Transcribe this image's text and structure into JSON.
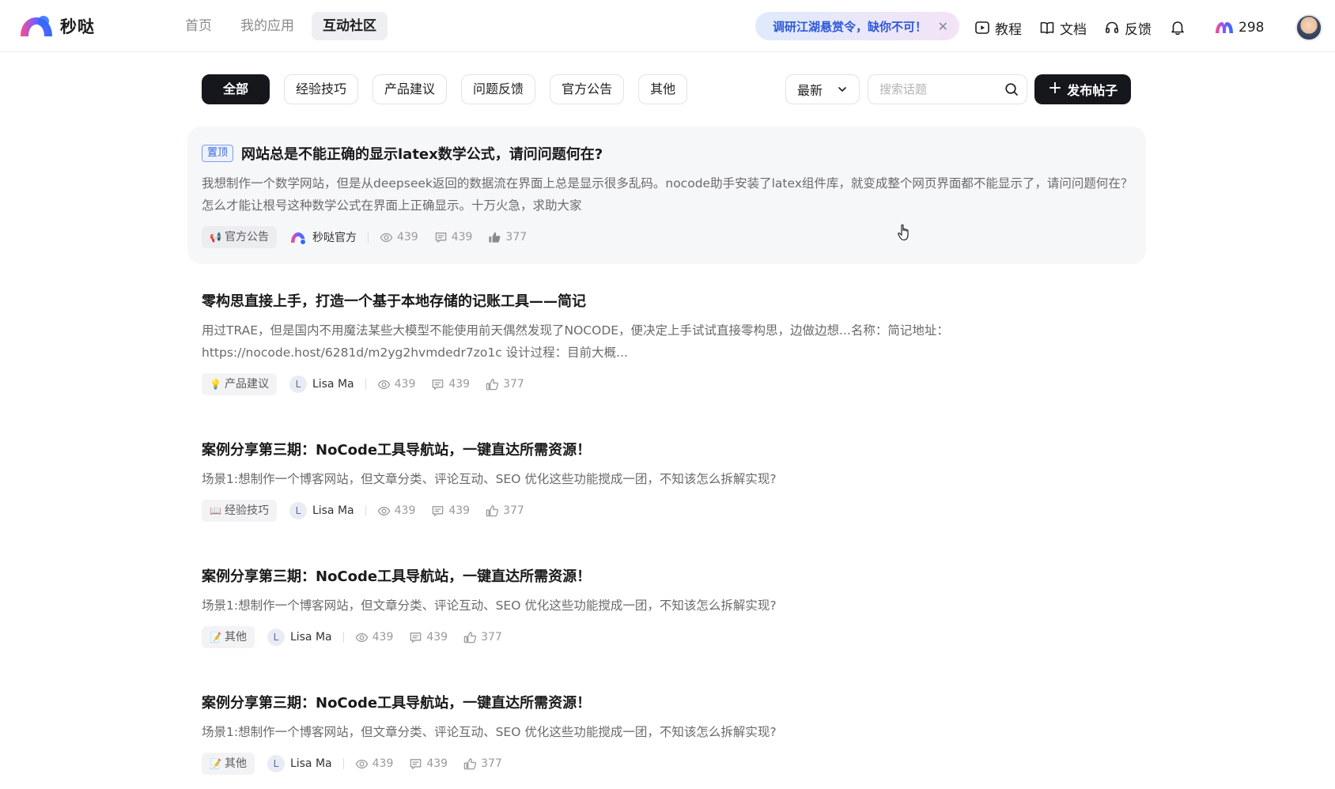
{
  "header": {
    "logo_text": "秒哒",
    "nav": [
      {
        "label": "首页",
        "active": false
      },
      {
        "label": "我的应用",
        "active": false
      },
      {
        "label": "互动社区",
        "active": true
      }
    ],
    "promo": {
      "text": "调研江湖悬赏令，缺你不可！"
    },
    "links": {
      "tutorial": "教程",
      "docs": "文档",
      "feedback": "反馈"
    },
    "credits": "298"
  },
  "filters": {
    "categories": [
      {
        "label": "全部",
        "active": true
      },
      {
        "label": "经验技巧",
        "active": false
      },
      {
        "label": "产品建议",
        "active": false
      },
      {
        "label": "问题反馈",
        "active": false
      },
      {
        "label": "官方公告",
        "active": false
      },
      {
        "label": "其他",
        "active": false
      }
    ],
    "sort": {
      "selected": "最新"
    },
    "search": {
      "placeholder": "搜索话题",
      "value": ""
    },
    "publish_label": "发布帖子"
  },
  "posts": [
    {
      "pinned": true,
      "pin_label": "置顶",
      "title": "网站总是不能正确的显示latex数学公式，请问问题何在?",
      "excerpt": "我想制作一个数学网站，但是从deepseek返回的数据流在界面上总是显示很多乱码。nocode助手安装了latex组件库，就变成整个网页界面都不能显示了，请问问题何在？怎么才能让根号这种数学公式在界面上正确显示。十万火急，求助大家",
      "category": "官方公告",
      "category_icon": "megaphone-icon",
      "author": "秒哒官方",
      "author_initial": "",
      "views": "439",
      "comments": "439",
      "likes": "377"
    },
    {
      "pinned": false,
      "title": "零构思直接上手，打造一个基于本地存储的记账工具——简记",
      "excerpt": "用过TRAE，但是国内不用魔法某些大模型不能使用前天偶然发现了NOCODE，便决定上手试试直接零构思，边做边想...名称：简记地址： https://nocode.host/6281d/m2yg2hvmdedr7zo1c 设计过程：目前大概...",
      "category": "产品建议",
      "category_icon": "lightbulb-icon",
      "author": "Lisa Ma",
      "author_initial": "L",
      "views": "439",
      "comments": "439",
      "likes": "377"
    },
    {
      "pinned": false,
      "title": "案例分享第三期：NoCode工具导航站，一键直达所需资源！",
      "excerpt": "场景1:想制作一个博客网站，但文章分类、评论互动、SEO 优化这些功能搅成一团，不知该怎么拆解实现?",
      "category": "经验技巧",
      "category_icon": "book-icon",
      "author": "Lisa Ma",
      "author_initial": "L",
      "views": "439",
      "comments": "439",
      "likes": "377"
    },
    {
      "pinned": false,
      "title": "案例分享第三期：NoCode工具导航站，一键直达所需资源！",
      "excerpt": "场景1:想制作一个博客网站，但文章分类、评论互动、SEO 优化这些功能搅成一团，不知该怎么拆解实现?",
      "category": "其他",
      "category_icon": "memo-icon",
      "author": "Lisa Ma",
      "author_initial": "L",
      "views": "439",
      "comments": "439",
      "likes": "377"
    },
    {
      "pinned": false,
      "title": "案例分享第三期：NoCode工具导航站，一键直达所需资源！",
      "excerpt": "场景1:想制作一个博客网站，但文章分类、评论互动、SEO 优化这些功能搅成一团，不知该怎么拆解实现?",
      "category": "其他",
      "category_icon": "memo-icon",
      "author": "Lisa Ma",
      "author_initial": "L",
      "views": "439",
      "comments": "439",
      "likes": "377"
    }
  ],
  "colors": {
    "primary_dark": "#15171c",
    "pin_blue": "#3e66d8",
    "promo_text": "#2e58d8",
    "pinned_bg": "#f6f7f9"
  }
}
